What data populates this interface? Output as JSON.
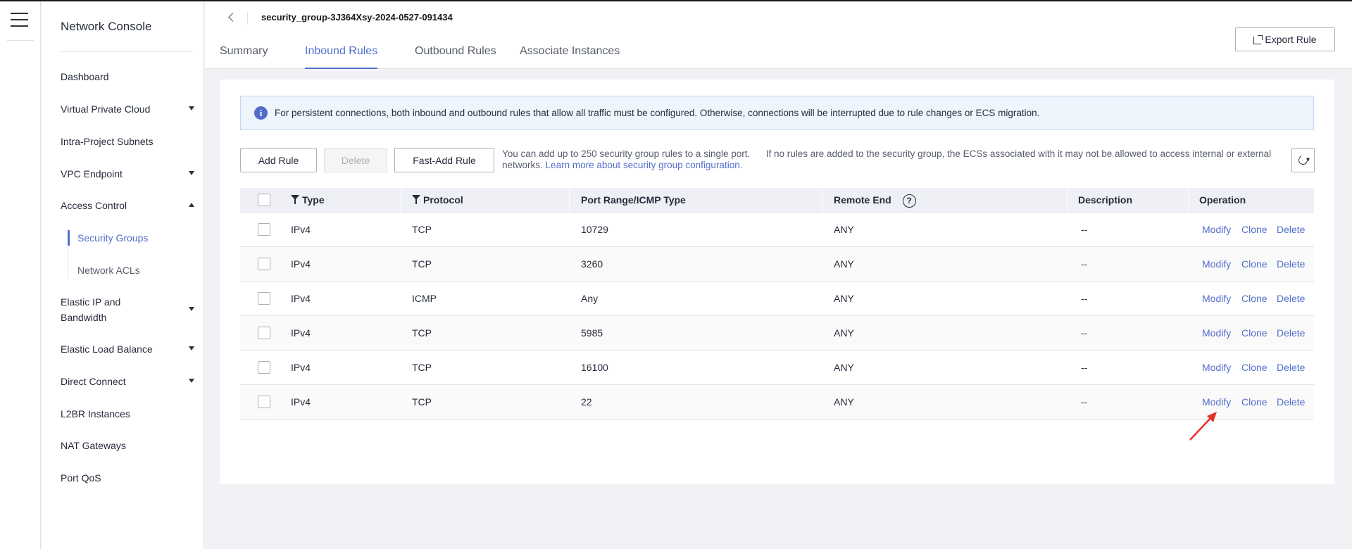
{
  "page": {
    "security_group_name": "security_group-3J364Xsy-2024-0527-091434",
    "export_label": "Export Rule",
    "icons": [
      "menu-icon",
      "back-icon",
      "export-icon",
      "info-icon",
      "refresh-icon",
      "filter-icon",
      "help-icon",
      "caret-icon"
    ]
  },
  "sidebar": {
    "title": "Network Console",
    "items": [
      {
        "label": "Dashboard"
      },
      {
        "label": "Virtual Private Cloud"
      },
      {
        "label": "Intra-Project Subnets"
      },
      {
        "label": "VPC Endpoint"
      },
      {
        "label": "Access Control"
      },
      {
        "label": "Elastic IP and Bandwidth"
      },
      {
        "label": "Elastic Load Balance"
      },
      {
        "label": "Direct Connect"
      },
      {
        "label": "L2BR Instances"
      },
      {
        "label": "NAT Gateways"
      },
      {
        "label": "Port QoS"
      }
    ],
    "subitems": [
      {
        "label": "Security Groups",
        "active": true
      },
      {
        "label": "Network ACLs",
        "active": false
      }
    ],
    "elastic_ip_line1": "Elastic IP and",
    "elastic_ip_line2": "Bandwidth"
  },
  "tabs": [
    {
      "label": "Summary"
    },
    {
      "label": "Inbound Rules",
      "active": true
    },
    {
      "label": "Outbound Rules"
    },
    {
      "label": "Associate Instances"
    }
  ],
  "notice": "For persistent connections, both inbound and outbound rules that allow all traffic must be configured. Otherwise, connections will be interrupted due to rule changes or ECS migration.",
  "toolbar": {
    "add_rule": "Add Rule",
    "delete": "Delete",
    "fast_add_rule": "Fast-Add Rule",
    "tip": "You can add up to 250 security group rules to a single port.      If no rules are added to the security group, the ECSs associated with it may not be allowed to access internal or external networks.",
    "tip_link": "Learn more about security group configuration."
  },
  "table": {
    "columns": {
      "type": "Type",
      "protocol": "Protocol",
      "port": "Port Range/ICMP Type",
      "remote": "Remote End",
      "description": "Description",
      "operation": "Operation"
    },
    "actions": {
      "modify": "Modify",
      "clone": "Clone",
      "delete": "Delete"
    },
    "rows": [
      {
        "type": "IPv4",
        "protocol": "TCP",
        "port": "10729",
        "remote": "ANY",
        "description": "--"
      },
      {
        "type": "IPv4",
        "protocol": "TCP",
        "port": "3260",
        "remote": "ANY",
        "description": "--"
      },
      {
        "type": "IPv4",
        "protocol": "ICMP",
        "port": "Any",
        "remote": "ANY",
        "description": "--"
      },
      {
        "type": "IPv4",
        "protocol": "TCP",
        "port": "5985",
        "remote": "ANY",
        "description": "--"
      },
      {
        "type": "IPv4",
        "protocol": "TCP",
        "port": "16100",
        "remote": "ANY",
        "description": "--"
      },
      {
        "type": "IPv4",
        "protocol": "TCP",
        "port": "22",
        "remote": "ANY",
        "description": "--"
      }
    ]
  },
  "colors": {
    "accent": "#526ecc",
    "annotation_arrow": "#e8312a"
  }
}
